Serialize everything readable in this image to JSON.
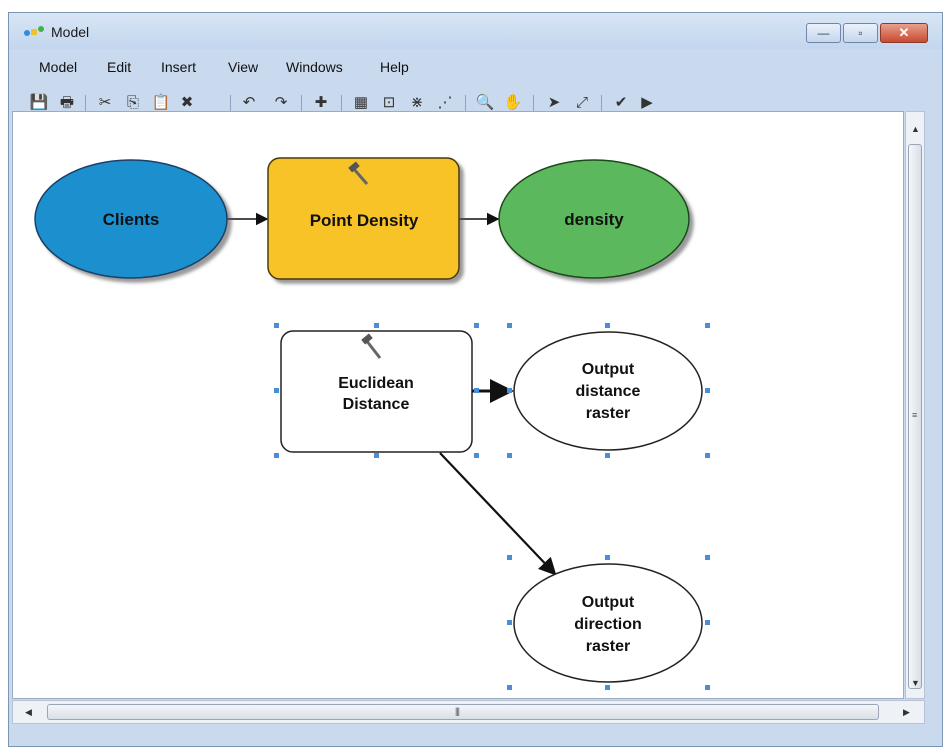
{
  "window": {
    "title": "Model",
    "buttons": {
      "minimize": "—",
      "maximize": "▫",
      "close": "✕"
    }
  },
  "menu": [
    "Model",
    "Edit",
    "Insert",
    "View",
    "Windows",
    "Help"
  ],
  "toolbar": [
    {
      "name": "save-icon",
      "glyph": "💾"
    },
    {
      "name": "print-icon",
      "glyph": "🖶"
    },
    {
      "name": "cut-icon",
      "glyph": "✂"
    },
    {
      "name": "copy-icon",
      "glyph": "⎘"
    },
    {
      "name": "paste-icon",
      "glyph": "📋"
    },
    {
      "name": "delete-icon",
      "glyph": "✖"
    },
    {
      "name": "undo-icon",
      "glyph": "↶"
    },
    {
      "name": "redo-icon",
      "glyph": "↷"
    },
    {
      "name": "add-data-icon",
      "glyph": "✚"
    },
    {
      "name": "auto-layout-icon",
      "glyph": "▦"
    },
    {
      "name": "full-extent-icon",
      "glyph": "⊡"
    },
    {
      "name": "fixed-zoom-in-icon",
      "glyph": "⋇"
    },
    {
      "name": "fixed-zoom-out-icon",
      "glyph": "⋰"
    },
    {
      "name": "zoom-in-icon",
      "glyph": "🔍"
    },
    {
      "name": "pan-icon",
      "glyph": "✋"
    },
    {
      "name": "select-icon",
      "glyph": "➤"
    },
    {
      "name": "connect-icon",
      "glyph": "⤢"
    },
    {
      "name": "validate-icon",
      "glyph": "✔"
    },
    {
      "name": "run-icon",
      "glyph": "▶"
    }
  ],
  "diagram": {
    "nodes": {
      "clients": {
        "lines": [
          "Clients"
        ],
        "color": "#1f8fcf"
      },
      "point_density": {
        "lines": [
          "Point Density"
        ],
        "color": "#f7c325"
      },
      "density": {
        "lines": [
          "density"
        ],
        "color": "#5cb85c"
      },
      "euclidean_distance": {
        "lines": [
          "Euclidean",
          "Distance"
        ],
        "color": "#ffffff"
      },
      "output_distance_raster": {
        "lines": [
          "Output",
          "distance",
          "raster"
        ],
        "color": "#ffffff"
      },
      "output_direction_raster": {
        "lines": [
          "Output",
          "direction",
          "raster"
        ],
        "color": "#ffffff"
      }
    },
    "selection_color": "#4a8fd6"
  }
}
